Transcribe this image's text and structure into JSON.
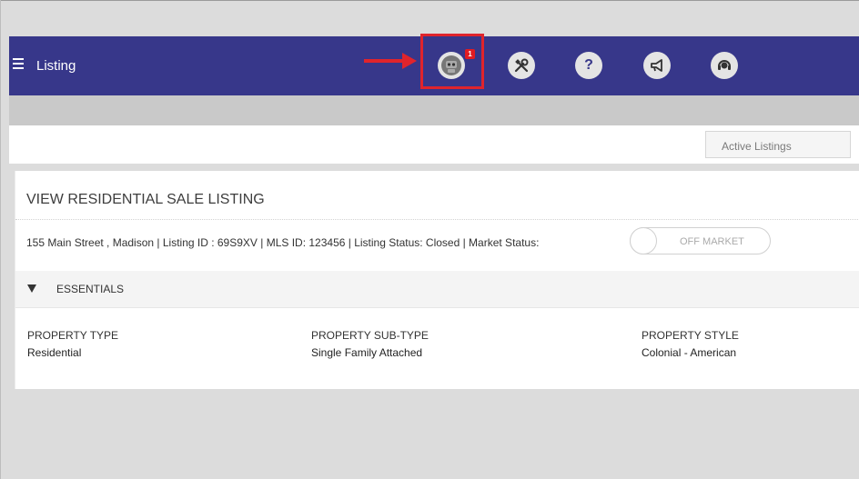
{
  "header": {
    "title": "Listing",
    "notification_count": "1",
    "help_label": "?"
  },
  "toolbar": {
    "status_filter": "Active Listings"
  },
  "listing": {
    "heading": "VIEW RESIDENTIAL SALE LISTING",
    "info_line": "155 Main Street , Madison | Listing ID : 69S9XV   | MLS ID: 123456   | Listing Status: Closed  | Market Status:",
    "market_toggle_label": "OFF MARKET",
    "section": {
      "label": "ESSENTIALS",
      "fields": [
        {
          "label": "PROPERTY TYPE",
          "value": "Residential"
        },
        {
          "label": "PROPERTY SUB-TYPE",
          "value": "Single Family Attached"
        },
        {
          "label": "PROPERTY STYLE",
          "value": "Colonial - American"
        }
      ]
    }
  },
  "colors": {
    "topbar": "#37378a",
    "highlight": "#e0242c",
    "badge": "#e11b22"
  },
  "icons": [
    "menu-icon",
    "robot-icon",
    "tools-icon",
    "help-icon",
    "megaphone-icon",
    "support-icon",
    "caret-down-icon",
    "arrow-icon"
  ]
}
